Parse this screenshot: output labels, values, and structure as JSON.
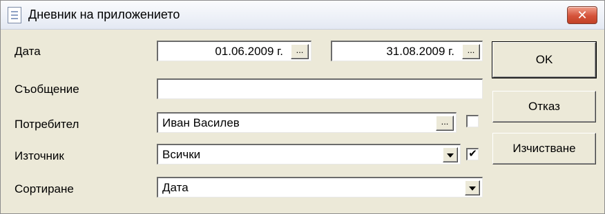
{
  "window": {
    "title": "Дневник на приложението",
    "close_label": "✕"
  },
  "rows": {
    "date": {
      "label": "Дата",
      "from": "01.06.2009 г.",
      "to": "31.08.2009 г.",
      "picker_label": "..."
    },
    "message": {
      "label": "Съобщение",
      "value": ""
    },
    "user": {
      "label": "Потребител",
      "value": "Иван Василев",
      "picker_label": "...",
      "checked": false
    },
    "source": {
      "label": "Източник",
      "value": "Всички",
      "checked": true,
      "check_mark": "✔"
    },
    "sort": {
      "label": "Сортиране",
      "value": "Дата"
    }
  },
  "buttons": {
    "ok": "OK",
    "cancel": "Отказ",
    "clear": "Изчистване"
  }
}
